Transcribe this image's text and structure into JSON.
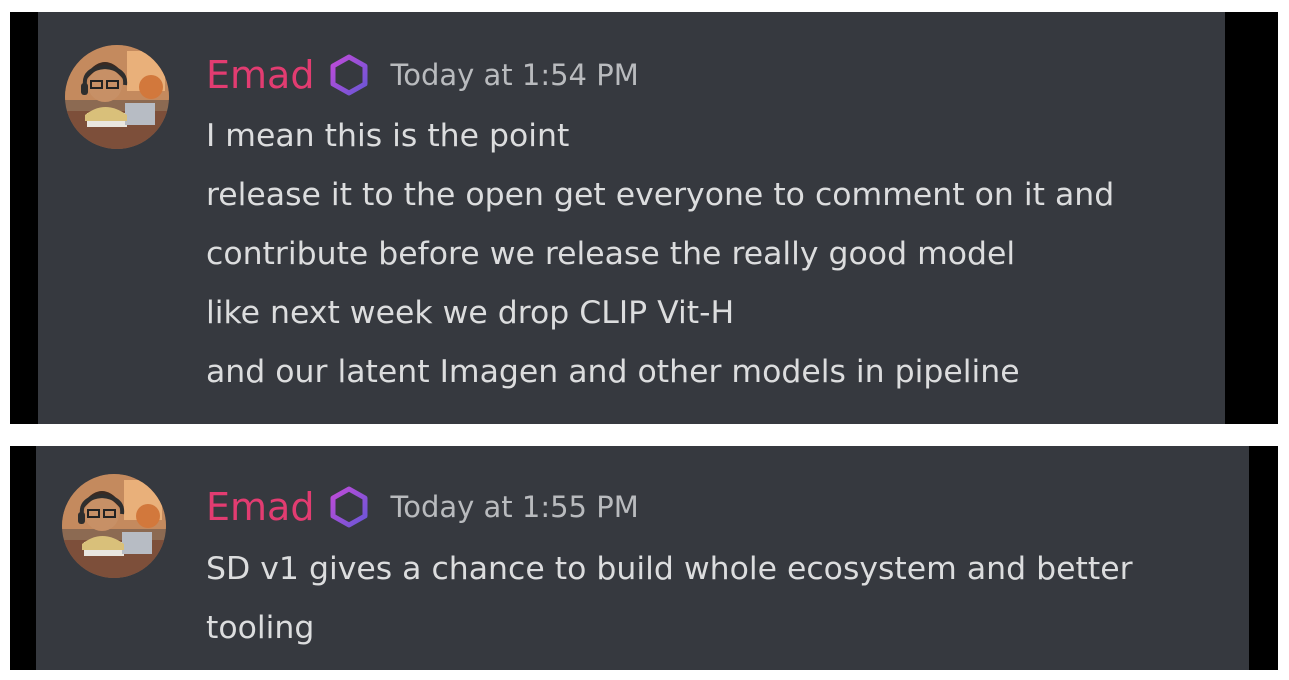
{
  "messages": [
    {
      "author": "Emad",
      "avatar_icon": "avatar-cartoon-person-icon",
      "role_icon": "hexagon-role-icon",
      "timestamp": "Today at 1:54 PM",
      "lines": [
        "I mean this is the point",
        "release it to the open get everyone to comment on it and",
        "contribute before we release the really good model",
        "like next week we drop CLIP Vit-H",
        "and our latent Imagen and other models in pipeline"
      ]
    },
    {
      "author": "Emad",
      "avatar_icon": "avatar-cartoon-person-icon",
      "role_icon": "hexagon-role-icon",
      "timestamp": "Today at 1:55 PM",
      "lines": [
        "SD v1 gives a chance to build whole ecosystem and better",
        "tooling"
      ]
    }
  ],
  "colors": {
    "username": "#e23c71",
    "background": "#36393f",
    "text": "#dcddde",
    "timestamp": "#b9bbbe"
  }
}
